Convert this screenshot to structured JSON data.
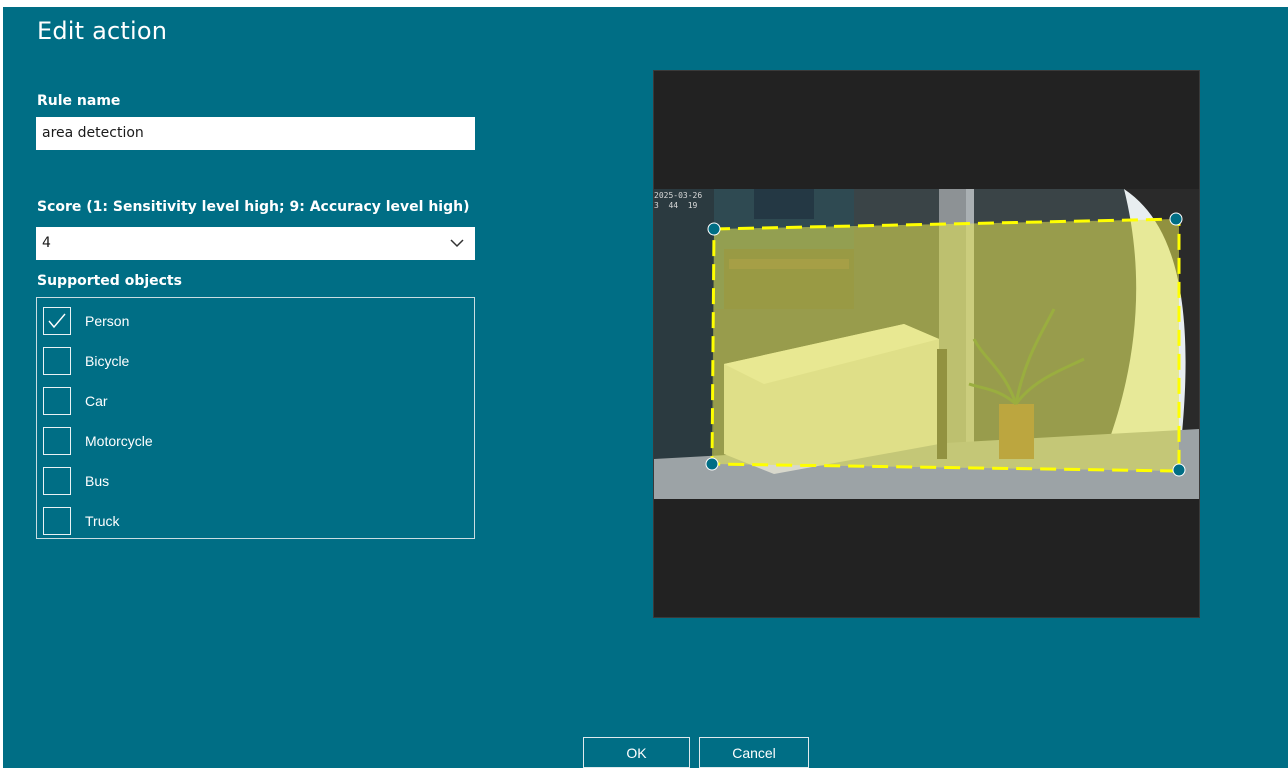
{
  "dialog": {
    "title": "Edit action"
  },
  "rule_name": {
    "label": "Rule name",
    "value": "area detection"
  },
  "score": {
    "label": "Score (1: Sensitivity level high; 9: Accuracy level high)",
    "value": "4"
  },
  "supported_objects": {
    "label": "Supported objects",
    "items": [
      {
        "label": "Person",
        "checked": true
      },
      {
        "label": "Bicycle",
        "checked": false
      },
      {
        "label": "Car",
        "checked": false
      },
      {
        "label": "Motorcycle",
        "checked": false
      },
      {
        "label": "Bus",
        "checked": false
      },
      {
        "label": "Truck",
        "checked": false
      }
    ]
  },
  "preview": {
    "timestamp_line1": "2025-03-26",
    "timestamp_line2": "3  44  19",
    "zone_color": "#ffff00",
    "handle_color": "#006e85"
  },
  "buttons": {
    "ok": "OK",
    "cancel": "Cancel"
  }
}
